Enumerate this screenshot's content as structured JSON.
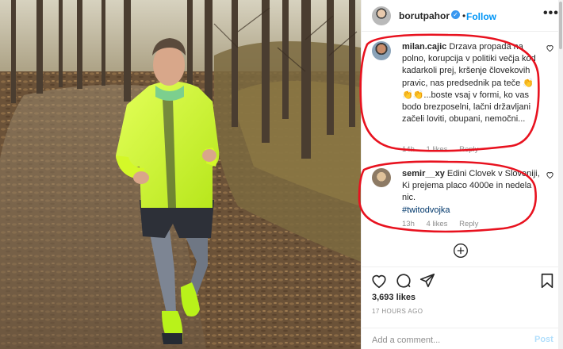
{
  "post": {
    "author": "borutpahor",
    "verified_glyph": "✓",
    "separator": "•",
    "follow_label": "Follow",
    "more_glyph": "•••"
  },
  "comments": [
    {
      "username": "milan.cajic",
      "text": "Drzava propada na polno, korupcija v politiki večja kod kadarkoli prej, kršenje človekovih pravic, nas predsednik pa teče 👏👏👏...boste vsaj v formi, ko vas bodo brezposelni, lačni državljani začeli loviti, obupani, nemočni...",
      "time": "14h",
      "likes": "1 likes",
      "reply": "Reply"
    },
    {
      "username": "semir__xy",
      "text": "Edini Clovek v Sloveniji, Ki prejema placo 4000e in nedela nic.",
      "hashtag": "#twitodvojka",
      "time": "13h",
      "likes": "4 likes",
      "reply": "Reply"
    }
  ],
  "footer": {
    "likes_count": "3,693 likes",
    "timestamp": "17 HOURS AGO",
    "comment_placeholder": "Add a comment...",
    "post_label": "Post"
  },
  "icons": {
    "like": "heart-icon",
    "comment": "comment-icon",
    "share": "share-icon",
    "save": "bookmark-icon",
    "load_more": "plus-circle-icon"
  },
  "colors": {
    "accent": "#0095f6",
    "verified": "#3897f0",
    "annotation": "#e8121f",
    "jacket": "#c8f51f"
  }
}
